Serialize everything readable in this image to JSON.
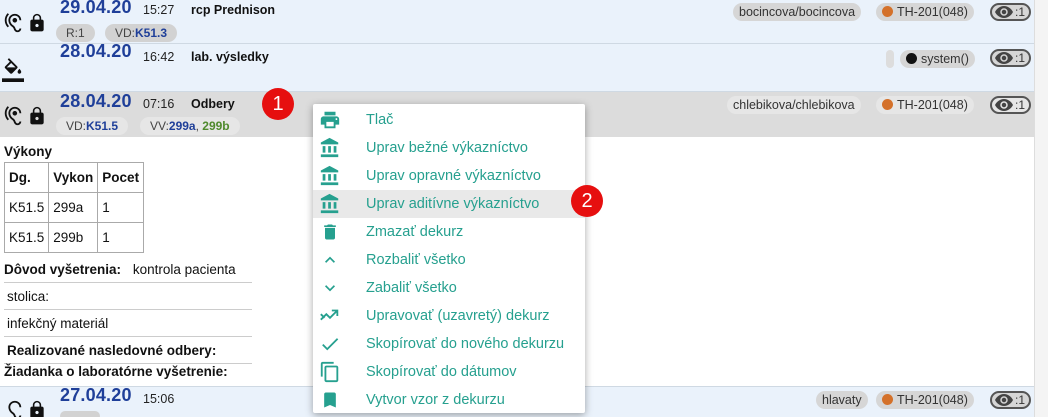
{
  "colors": {
    "accent": "#26a08f",
    "date": "#1f3f99",
    "badge": "#e60f0f",
    "user_dot": "#d4712a"
  },
  "rows": [
    {
      "date": "29.04.20",
      "time": "15:27",
      "title": "rcp Prednison",
      "pills": {
        "r": "R:1",
        "vd_prefix": "VD:",
        "vd_value": "K51.3"
      },
      "user": "bocincova/bocincova",
      "clinic": "TH-201(048)",
      "views": ":1",
      "icons": [
        "ear-icon",
        "lock-icon"
      ]
    },
    {
      "date": "28.04.20",
      "time": "16:42",
      "title": "lab. výsledky",
      "user": "system()",
      "views": ":1",
      "icons": [
        "paint-bucket-icon"
      ]
    },
    {
      "date": "28.04.20",
      "time": "07:16",
      "title": "Odbery",
      "pills": {
        "vd_prefix": "VD:",
        "vd_value": "K51.5",
        "vv_prefix": "VV:",
        "vv_value1": "299a",
        "vv_sep": ", ",
        "vv_value2": "299b"
      },
      "user": "chlebikova/chlebikova",
      "clinic": "TH-201(048)",
      "views": ":1",
      "icons": [
        "ear-icon",
        "lock-icon"
      ]
    },
    {
      "date": "27.04.20",
      "time": "15:06",
      "user": "hlavaty",
      "clinic": "TH-201(048)",
      "views": ":1",
      "icons": [
        "ear-icon",
        "lock-icon"
      ]
    }
  ],
  "detail": {
    "vykony_label": "Výkony",
    "table": {
      "headers": [
        "Dg.",
        "Vykon",
        "Pocet"
      ],
      "rows": [
        [
          "K51.5",
          "299a",
          "1"
        ],
        [
          "K51.5",
          "299b",
          "1"
        ]
      ]
    },
    "dovod_label": "Dôvod vyšetrenia:",
    "dovod_value": "kontrola pacienta",
    "stolica_label": "stolica:",
    "infekcny_label": "infekčný materiál",
    "realizovane_label": "Realizované nasledovné odbery:",
    "ziadanka_label": "Žiadanka o laboratórne vyšetrenie:"
  },
  "badges": {
    "first": "1",
    "second": "2"
  },
  "menu": [
    {
      "label": "Tlač",
      "icon": "printer-icon"
    },
    {
      "label": "Uprav bežné výkazníctvo",
      "icon": "bank-icon"
    },
    {
      "label": "Uprav opravné výkazníctvo",
      "icon": "bank-icon"
    },
    {
      "label": "Uprav aditívne výkazníctvo",
      "icon": "bank-icon",
      "highlighted": true
    },
    {
      "label": "Zmazať dekurz",
      "icon": "trash-icon"
    },
    {
      "label": "Rozbaliť všetko",
      "icon": "chevron-up-icon"
    },
    {
      "label": "Zabaliť všetko",
      "icon": "chevron-down-icon"
    },
    {
      "label": "Upravovať (uzavretý) dekurz",
      "icon": "trending-icon"
    },
    {
      "label": "Skopírovať do nového dekurzu",
      "icon": "check-icon"
    },
    {
      "label": "Skopírovať do dátumov",
      "icon": "copy-icon"
    },
    {
      "label": "Vytvor vzor z dekurzu",
      "icon": "bookmark-icon"
    }
  ]
}
